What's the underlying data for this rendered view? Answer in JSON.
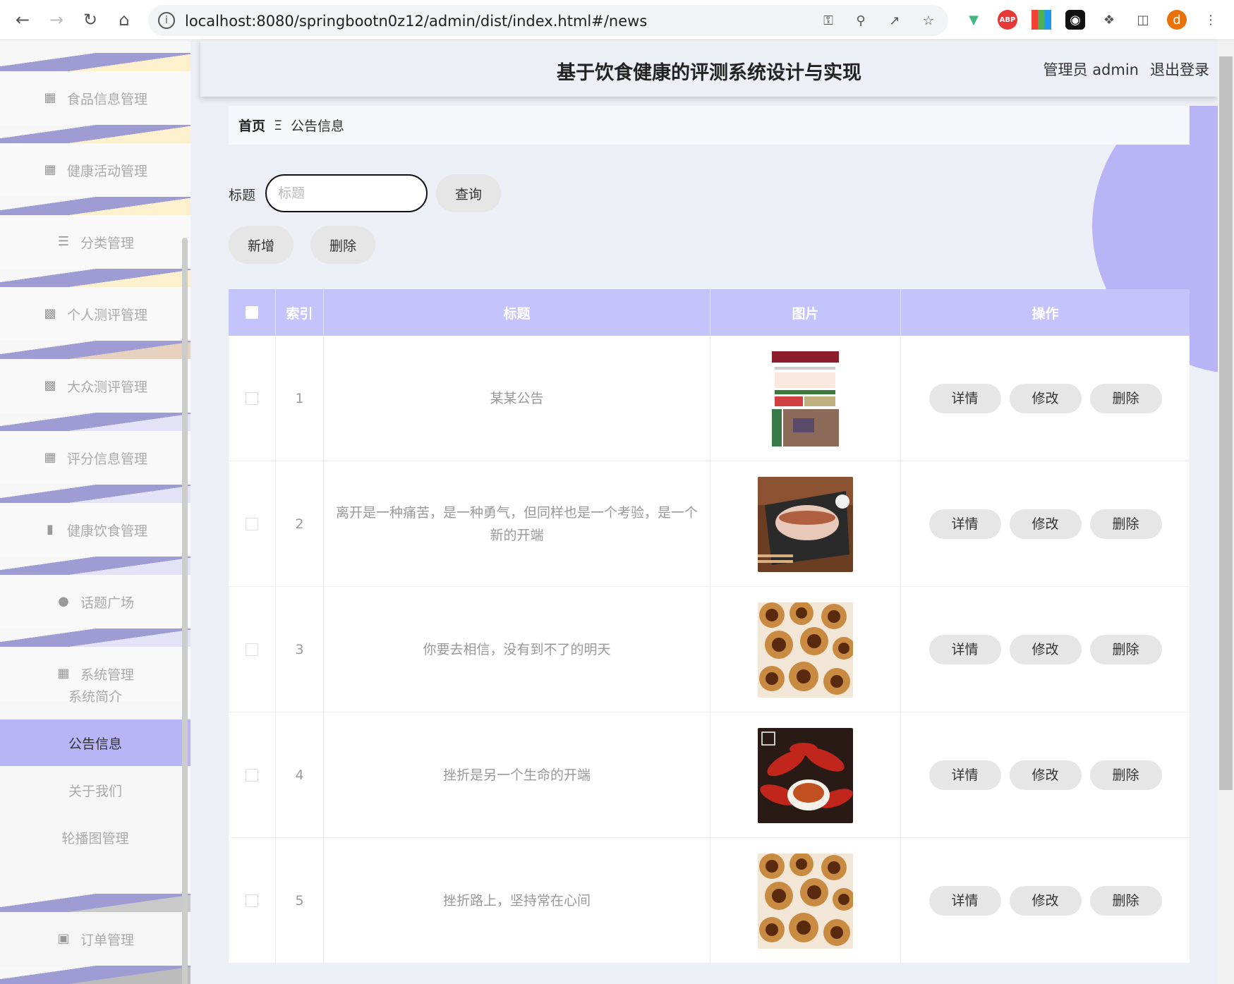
{
  "browser": {
    "url": "localhost:8080/springbootn0z12/admin/dist/index.html#/news",
    "profile_initial": "d",
    "abp": "ABP",
    "icons": [
      "back-icon",
      "forward-icon",
      "reload-icon",
      "home-icon",
      "key-icon",
      "zoom-icon",
      "share-icon",
      "star-icon",
      "vue-devtools-icon",
      "adblock-icon",
      "color-picker-icon",
      "incognito-extension-icon",
      "puzzle-icon",
      "sidebar-icon",
      "menu-dots-icon"
    ]
  },
  "header": {
    "title": "基于饮食健康的评测系统设计与实现",
    "admin": "管理员 admin",
    "logout": "退出登录"
  },
  "sidebar": {
    "items": [
      {
        "label": "食品信息管理",
        "icon": "grid-icon"
      },
      {
        "label": "健康活动管理",
        "icon": "grid-icon"
      },
      {
        "label": "分类管理",
        "icon": "list-icon"
      },
      {
        "label": "个人测评管理",
        "icon": "apps-icon"
      },
      {
        "label": "大众测评管理",
        "icon": "monitor-icon"
      },
      {
        "label": "评分信息管理",
        "icon": "grid-icon"
      },
      {
        "label": "健康饮食管理",
        "icon": "bar-chart-icon"
      },
      {
        "label": "话题广场",
        "icon": "user-icon"
      },
      {
        "label": "系统管理",
        "icon": "grid-icon"
      }
    ],
    "sub_items": [
      "系统简介",
      "公告信息",
      "关于我们",
      "轮播图管理"
    ],
    "last_item": {
      "label": "订单管理",
      "icon": "clipboard-icon"
    }
  },
  "breadcrumb": {
    "home": "首页",
    "separator": "Ξ",
    "current": "公告信息"
  },
  "search": {
    "label": "标题",
    "placeholder": "标题",
    "value": "",
    "button": "查询"
  },
  "toolbar": {
    "add": "新增",
    "delete": "删除"
  },
  "table": {
    "headers": [
      "索引",
      "标题",
      "图片",
      "操作"
    ],
    "actions": [
      "详情",
      "修改",
      "删除"
    ],
    "rows": [
      {
        "index": "1",
        "title": "某某公告",
        "image": "magazine-cover"
      },
      {
        "index": "2",
        "title": "离开是一种痛苦，是一种勇气，但同样也是一个考验，是一个新的开端",
        "image": "roast-pork"
      },
      {
        "index": "3",
        "title": "你要去相信，没有到不了的明天",
        "image": "egg-tarts"
      },
      {
        "index": "4",
        "title": "挫折是另一个生命的开端",
        "image": "crayfish"
      },
      {
        "index": "5",
        "title": "挫折路上，坚持常在心间",
        "image": "egg-tarts"
      }
    ]
  },
  "colors": {
    "accent": "#c4c3fb",
    "active_menu": "#b8b4f5",
    "deco_purple": "#9f9cd4"
  }
}
